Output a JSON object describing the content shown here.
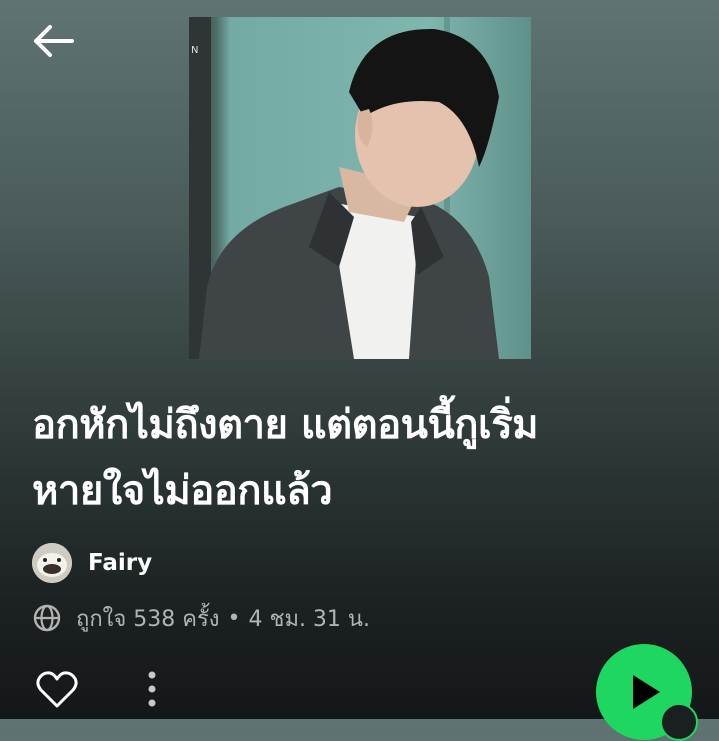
{
  "playlist": {
    "title_line1": "อกหักไม่ถึงตาย แต่ตอนนี้กูเริ่ม",
    "title_line2": "หายใจไม่ออกแล้ว",
    "owner": "Fairy",
    "likes": "ถูกใจ 538 ครั้ง",
    "separator": "•",
    "duration": "4 ชม. 31 น.",
    "cover_text": "N"
  },
  "icons": {
    "back": "arrow-left-icon",
    "globe": "globe-icon",
    "heart": "heart-icon",
    "more": "more-vertical-icon",
    "play": "play-icon"
  },
  "colors": {
    "accent": "#1ed760",
    "text": "#ffffff",
    "subtext": "#b3b3b3"
  }
}
